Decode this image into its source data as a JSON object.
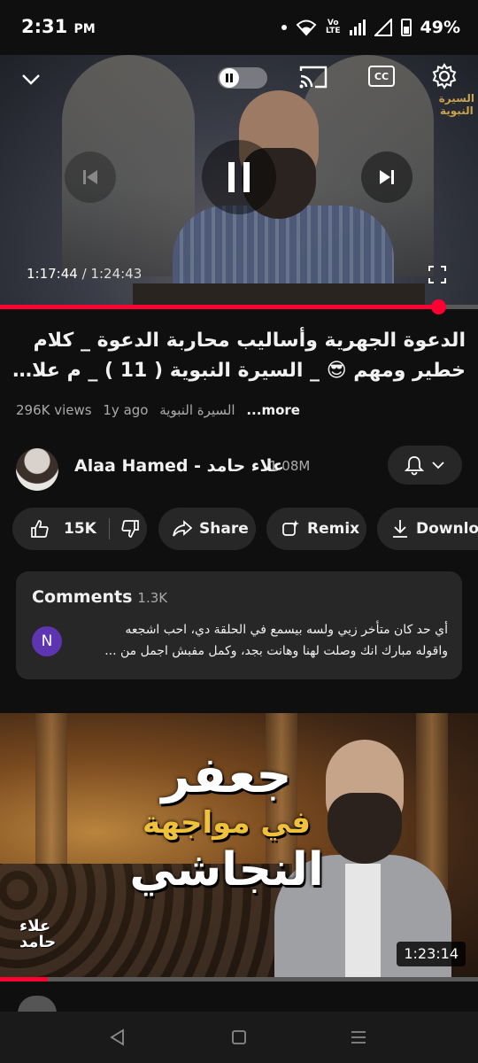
{
  "status_bar": {
    "time": "2:31",
    "ampm": "PM",
    "volte_top": "Vo",
    "volte_bottom": "LTE",
    "battery": "49%"
  },
  "player": {
    "watermark_line1": "السيرة",
    "watermark_line2": "النبوية",
    "current_time": "1:17:44",
    "separator": " / ",
    "total_time": "1:24:43",
    "cc_label": "CC",
    "progress_fraction": 0.917
  },
  "video": {
    "title_line1": "الدعوة الجهرية  وأساليب محاربة الدعوة _ كلام",
    "title_line2": "خطير ومهم 😎 _ السيرة النبوية ( 11 ) _ م علاء ...",
    "views": "296K views",
    "age": "1y ago",
    "playlist": "السيرة النبوية",
    "more_label": "...more"
  },
  "channel": {
    "name": "Alaa Hamed - علاء حامد",
    "subscribers": "1.08M"
  },
  "actions": {
    "like_count": "15K",
    "share_label": "Share",
    "remix_label": "Remix",
    "download_label": "Download"
  },
  "comments": {
    "heading": "Comments",
    "count": "1.3K",
    "avatar_letter": "N",
    "preview_line1": "أي حد كان متأخر زيي ولسه بيسمع في الحلقة دي، احب اشجعه",
    "preview_line2": "واقوله مبارك انك وصلت لهنا وهانت بجد، وكمل مفبش اجمل من ..."
  },
  "next_video": {
    "thumb_line1": "جعفر",
    "thumb_line2": "في مواجهة",
    "thumb_line3": "النجاشي",
    "thumb_logo_line1": "علاء",
    "thumb_logo_line2": "حامد",
    "duration": "1:23:14",
    "watched_fraction": 0.1
  },
  "colors": {
    "accent": "#ff0033",
    "background": "#0f0f0f",
    "surface": "#272727",
    "comment_avatar": "#5e35b1"
  }
}
